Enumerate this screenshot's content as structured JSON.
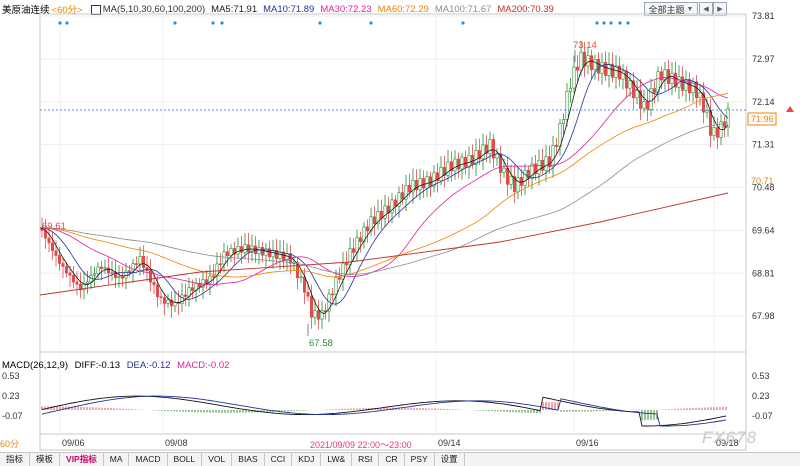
{
  "legend": {
    "name": "美原油连续",
    "period": "<60分>",
    "ma_label": "MA(5,10,30,60,100,200)",
    "ma5": "MA5:71.91",
    "ma10": "MA10:71.89",
    "ma30": "MA30:72.23",
    "ma60": "MA60:72.29",
    "ma100": "MA100:71.67",
    "ma200": "MA200:70.39"
  },
  "toolbar": {
    "theme_label": "全部主题",
    "prev": "◀",
    "next": "▶"
  },
  "price_axis": {
    "labels": [
      "73.81",
      "72.97",
      "72.14",
      "71.31",
      "70.48",
      "69.64",
      "68.81",
      "67.98"
    ],
    "current_price_tag": "71.96",
    "ma200_tag": "70.71"
  },
  "annotations": {
    "high": "73.14",
    "low": "67.58",
    "left_value": "69.61"
  },
  "macd": {
    "label": "MACD(26,12,9)",
    "diff": "DIFF:-0.13",
    "dea": "DEA:-0.12",
    "macd": "MACD:-0.02",
    "axis": [
      "0.53",
      "0.23",
      "-0.07"
    ]
  },
  "dates": [
    "09/06",
    "09/08",
    "09/14",
    "09/16",
    "09/18"
  ],
  "crosshair_time": "2021/09/09 22:00～23:00",
  "corner_tag": "60分",
  "watermark": "FX678",
  "tabs": [
    "指标",
    "模板",
    "VIP指标",
    "MA",
    "MACD",
    "BOLL",
    "VOL",
    "BIAS",
    "CCI",
    "KDJ",
    "LW&",
    "RSI",
    "CR",
    "PSY",
    "设置"
  ],
  "colors": {
    "up": "#2a8a2a",
    "down": "#e24b4b",
    "ma5": "#1a1a1a",
    "ma10": "#23329a",
    "ma30": "#e31ea0",
    "ma60": "#f08300",
    "ma100": "#8c8c8c",
    "ma200": "#c0302a"
  }
}
